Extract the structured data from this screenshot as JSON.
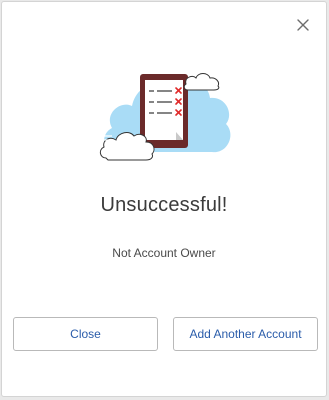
{
  "dialog": {
    "title": "Unsuccessful!",
    "message": "Not Account Owner",
    "close_icon": "close-icon",
    "illustration_icon": "checklist-failed-icon"
  },
  "buttons": {
    "close_label": "Close",
    "add_account_label": "Add Another Account"
  },
  "colors": {
    "button_text": "#2a5caa",
    "cloud_fill": "#a9dcf6",
    "device_frame": "#6b2a2a",
    "fail_mark": "#e02b2b",
    "title_text": "#3b3b3b"
  }
}
